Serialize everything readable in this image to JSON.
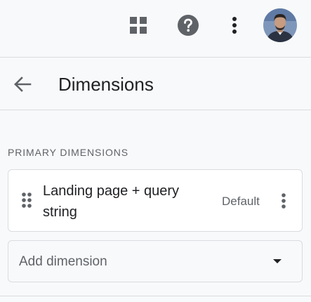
{
  "topbar": {
    "apps_icon": "apps-grid-icon",
    "help_icon": "help-circle-icon",
    "more_icon": "more-vert-icon",
    "avatar_icon": "user-avatar"
  },
  "header": {
    "back_icon": "arrow-back-icon",
    "title": "Dimensions"
  },
  "primary": {
    "section_label": "PRIMARY DIMENSIONS",
    "dimensions": [
      {
        "name": "Landing page + query string",
        "badge": "Default",
        "drag_icon": "drag-indicator-icon",
        "more_icon": "more-vert-icon"
      }
    ],
    "add_dimension": {
      "label": "Add dimension",
      "caret_icon": "arrow-drop-down-icon"
    }
  },
  "colors": {
    "background": "#f8f9fa",
    "card": "#ffffff",
    "divider": "#dadce0",
    "icon": "#5f6368",
    "text_primary": "#202124",
    "text_secondary": "#5f6368"
  }
}
